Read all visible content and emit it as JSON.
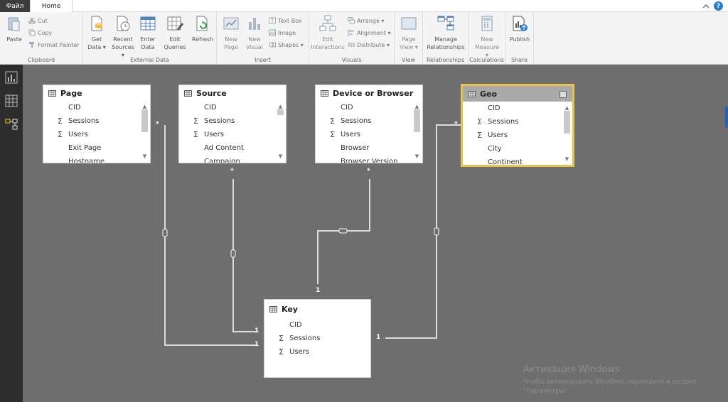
{
  "tabs": {
    "file": "Файл",
    "home": "Home"
  },
  "ribbon": {
    "clipboard": {
      "label": "Clipboard",
      "paste": "Paste",
      "cut": "Cut",
      "copy": "Copy",
      "format_painter": "Format Painter"
    },
    "external_data": {
      "label": "External Data",
      "get_data": "Get",
      "get_data2": "Data ▾",
      "recent": "Recent",
      "recent2": "Sources ▾",
      "enter": "Enter",
      "enter2": "Data",
      "edit": "Edit",
      "edit2": "Queries",
      "refresh": "Refresh"
    },
    "insert": {
      "label": "Insert",
      "new_page": "New",
      "new_page2": "Page",
      "new_visual": "New",
      "new_visual2": "Visual",
      "text_box": "Text Box",
      "image": "Image",
      "shapes": "Shapes ▾"
    },
    "visuals": {
      "label": "Visuals",
      "edit_inter": "Edit",
      "edit_inter2": "Interactions",
      "arrange": "Arrange ▾",
      "alignment": "Alignment ▾",
      "distribute": "Distribute ▾"
    },
    "view": {
      "label": "View",
      "page_view": "Page",
      "page_view2": "View ▾"
    },
    "relationships": {
      "label": "Relationships",
      "manage": "Manage",
      "manage2": "Relationships"
    },
    "calculations": {
      "label": "Calculations",
      "new_measure": "New",
      "new_measure2": "Measure ▾"
    },
    "share": {
      "label": "Share",
      "publish": "Publish"
    }
  },
  "tables": {
    "page": {
      "title": "Page",
      "fields": [
        {
          "sigma": "",
          "name": "CID"
        },
        {
          "sigma": "Σ",
          "name": "Sessions"
        },
        {
          "sigma": "Σ",
          "name": "Users"
        },
        {
          "sigma": "",
          "name": "Exit Page"
        },
        {
          "sigma": "",
          "name": "Hostname"
        }
      ]
    },
    "source": {
      "title": "Source",
      "fields": [
        {
          "sigma": "",
          "name": "CID"
        },
        {
          "sigma": "Σ",
          "name": "Sessions"
        },
        {
          "sigma": "Σ",
          "name": "Users"
        },
        {
          "sigma": "",
          "name": "Ad Content"
        },
        {
          "sigma": "",
          "name": "Campaign"
        }
      ]
    },
    "device": {
      "title": "Device or Browser",
      "fields": [
        {
          "sigma": "",
          "name": "CID"
        },
        {
          "sigma": "Σ",
          "name": "Sessions"
        },
        {
          "sigma": "Σ",
          "name": "Users"
        },
        {
          "sigma": "",
          "name": "Browser"
        },
        {
          "sigma": "",
          "name": "Browser Version"
        }
      ]
    },
    "geo": {
      "title": "Geo",
      "fields": [
        {
          "sigma": "",
          "name": "CID"
        },
        {
          "sigma": "Σ",
          "name": "Sessions"
        },
        {
          "sigma": "Σ",
          "name": "Users"
        },
        {
          "sigma": "",
          "name": "City"
        },
        {
          "sigma": "",
          "name": "Continent"
        }
      ]
    },
    "key": {
      "title": "Key",
      "fields": [
        {
          "sigma": "",
          "name": "CID"
        },
        {
          "sigma": "Σ",
          "name": "Sessions"
        },
        {
          "sigma": "Σ",
          "name": "Users"
        }
      ]
    }
  },
  "relations": {
    "many": "*",
    "one": "1"
  },
  "watermark": {
    "title": "Активация Windows",
    "text": "Чтобы активировать Windows, перейдите в раздел \"Параметры\"."
  }
}
